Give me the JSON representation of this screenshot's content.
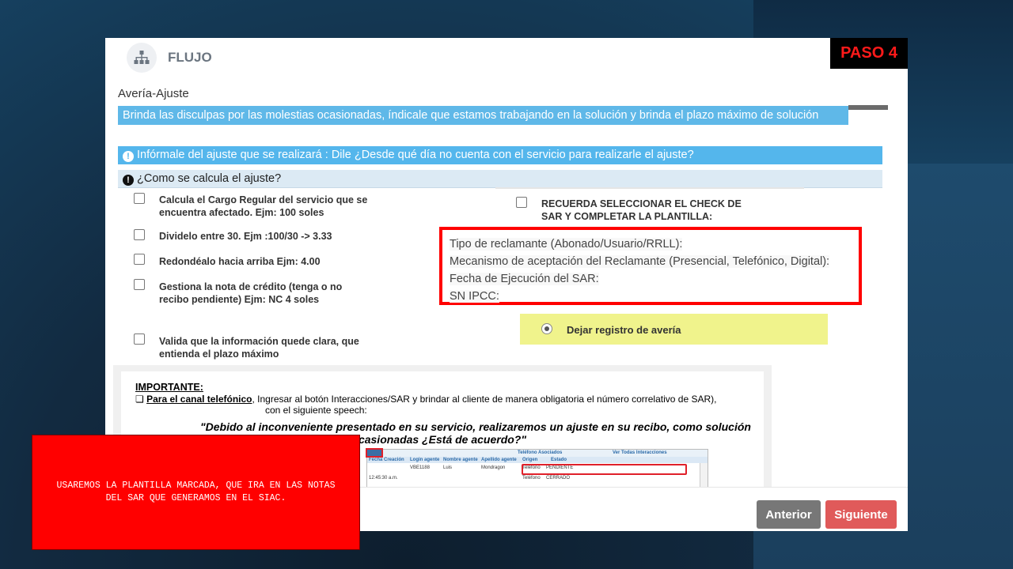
{
  "header": {
    "title": "FLUJO",
    "icon": "sitemap-icon",
    "step_badge": "PASO 4"
  },
  "subtitle": "Avería-Ajuste",
  "apology_banner": "Brinda las disculpas por las molestias ocasionadas, índicale que estamos trabajando en la solución y brinda el plazo máximo de solución",
  "info_bar": "Infórmale del ajuste que se realizará : Dile ¿Desde qué día no cuenta con el servicio para realizarle el ajuste?",
  "calc_bar": "¿Como se calcula el ajuste?",
  "checklist": [
    {
      "label": "Calcula el Cargo Regular del servicio que se encuentra afectado. Ejm: 100 soles",
      "checked": false
    },
    {
      "label": "Dividelo entre 30. Ejm :100/30 -> 3.33",
      "checked": false
    },
    {
      "label": "Redondéalo hacia arriba Ejm: 4.00",
      "checked": false
    },
    {
      "label": "Gestiona la nota de crédito (tenga o no recibo pendiente) Ejm: NC 4 soles",
      "checked": false
    },
    {
      "label": "Valida que la información quede clara, que entienda el plazo máximo",
      "checked": false
    }
  ],
  "reminder_check": {
    "label": "RECUERDA SELECCIONAR EL CHECK DE SAR Y COMPLETAR LA PLANTILLA:",
    "checked": false
  },
  "template_fields": [
    "Tipo de reclamante (Abonado/Usuario/RRLL):",
    "Mecanismo de aceptación del Reclamante (Presencial, Telefónico, Digital):",
    "Fecha de Ejecución del SAR:",
    "SN IPCC:"
  ],
  "radio_option": {
    "label": "Dejar registro de avería",
    "selected": true
  },
  "important": {
    "title": "IMPORTANTE:",
    "channel": "Para el canal telefónico",
    "text_line1": ", Ingresar al botón Interacciones/SAR y brindar al cliente de manera obligatoria el número correlativo de SAR),",
    "text_line2": "con el siguiente speech:",
    "quote": "\"Debido al inconveniente presentado en su servicio, realizaremos un ajuste en su recibo, como solución anticipada por las molestias ocasionadas ¿Está de acuerdo?\"",
    "mini_table": {
      "headers": [
        "Teléfono Asociados",
        "Ver Todas Interacciones"
      ],
      "columns": [
        "Fecha Creación",
        "Login agente",
        "Nombre agente",
        "Apellido agente",
        "Origen",
        "Estado"
      ],
      "row1": [
        "",
        "VBE1188",
        "Luis",
        "Mondragon",
        "Teléfono",
        "PENDIENTE"
      ],
      "row2": [
        "12:45:30 a.m.",
        "",
        "",
        "",
        "Teléfono",
        "CERRADO"
      ]
    }
  },
  "buttons": {
    "prev": "Anterior",
    "next": "Siguiente"
  },
  "note": "USAREMOS LA PLANTILLA MARCADA, QUE IRA EN LAS NOTAS DEL SAR QUE GENERAMOS EN EL SIAC."
}
